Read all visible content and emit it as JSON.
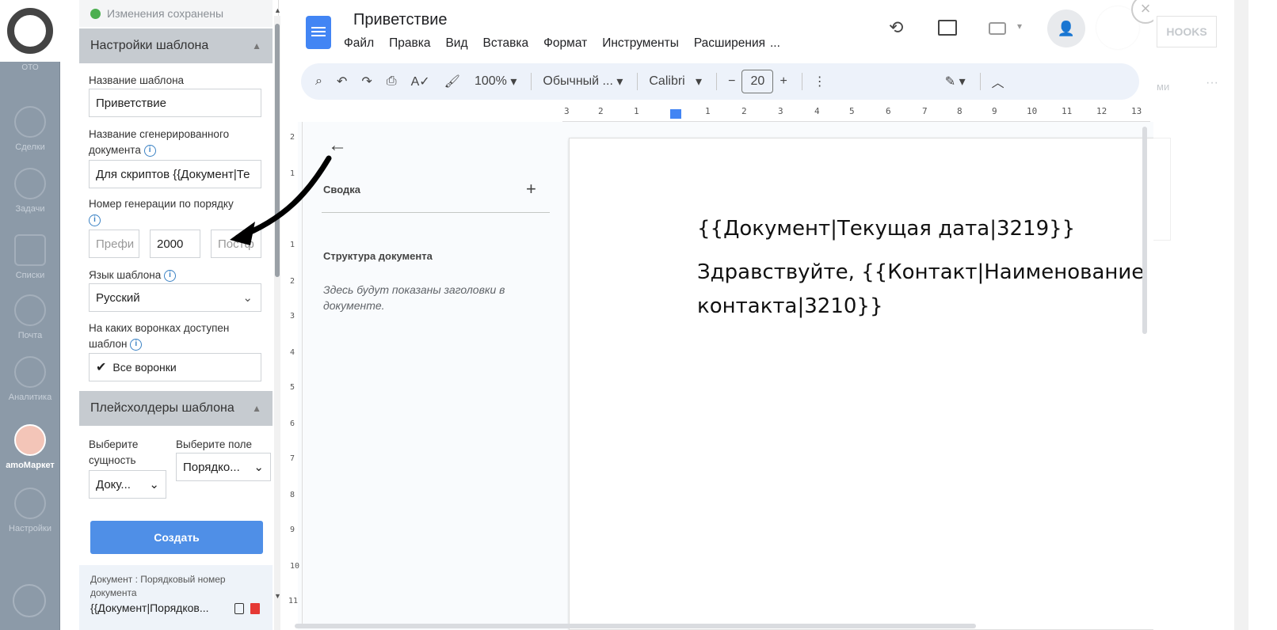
{
  "crm_sidebar": {
    "items": [
      {
        "label": "Сделки",
        "icon": "dollar-icon"
      },
      {
        "label": "Задачи",
        "icon": "check-icon"
      },
      {
        "label": "Списки",
        "icon": "list-icon"
      },
      {
        "label": "Почта",
        "icon": "mail-icon"
      },
      {
        "label": "Аналитика",
        "icon": "chart-icon"
      },
      {
        "label": "amoМаркет",
        "icon": "market-icon"
      },
      {
        "label": "Настройки",
        "icon": "wrench-icon"
      }
    ],
    "top_partial": "ОТО"
  },
  "panel": {
    "saved_status": "Изменения сохранены",
    "settings_header": "Настройки шаблона",
    "template_name_label": "Название шаблона",
    "template_name_value": "Приветствие",
    "gen_doc_name_label": "Название сгенерированного документа",
    "gen_doc_name_value": "Для скриптов {{Документ|Те",
    "gen_number_label": "Номер генерации по порядку",
    "prefix_placeholder": "Префи",
    "number_value": "2000",
    "postfix_placeholder": "Постф",
    "lang_label": "Язык шаблона",
    "lang_value": "Русский",
    "pipelines_label": "На каких воронках доступен шаблон",
    "pipelines_value": "Все воронки",
    "placeholders_header": "Плейсхолдеры шаблона",
    "entity_label": "Выберите сущность",
    "entity_value": "Доку...",
    "field_label": "Выберите поле",
    "field_value": "Порядко...",
    "create_button": "Создать",
    "ph_title": "Документ : Порядковый номер документа",
    "ph_code": "{{Документ|Порядков..."
  },
  "docs": {
    "title": "Приветствие",
    "menu": [
      "Файл",
      "Правка",
      "Вид",
      "Вставка",
      "Формат",
      "Инструменты",
      "Расширения",
      "..."
    ],
    "zoom": "100%",
    "style": "Обычный ...",
    "font": "Calibri",
    "font_size": "20",
    "outline_summary": "Сводка",
    "outline_structure": "Структура документа",
    "outline_hint": "Здесь будут показаны заголовки в документе.",
    "line1": "{{Документ|Текущая дата|3219}}",
    "line2": "Здравствуйте, {{Контакт|Наименование контакта|3210}}",
    "bg_hooks": "HOOKS",
    "bg_partial": "ми",
    "ruler_h": [
      "3",
      "2",
      "1",
      "1",
      "2",
      "3",
      "4",
      "5",
      "6",
      "7",
      "8",
      "9",
      "10",
      "11",
      "12",
      "13"
    ],
    "ruler_v": [
      "2",
      "1",
      "1",
      "2",
      "3",
      "4",
      "5",
      "6",
      "7",
      "8",
      "9",
      "10",
      "11"
    ]
  }
}
